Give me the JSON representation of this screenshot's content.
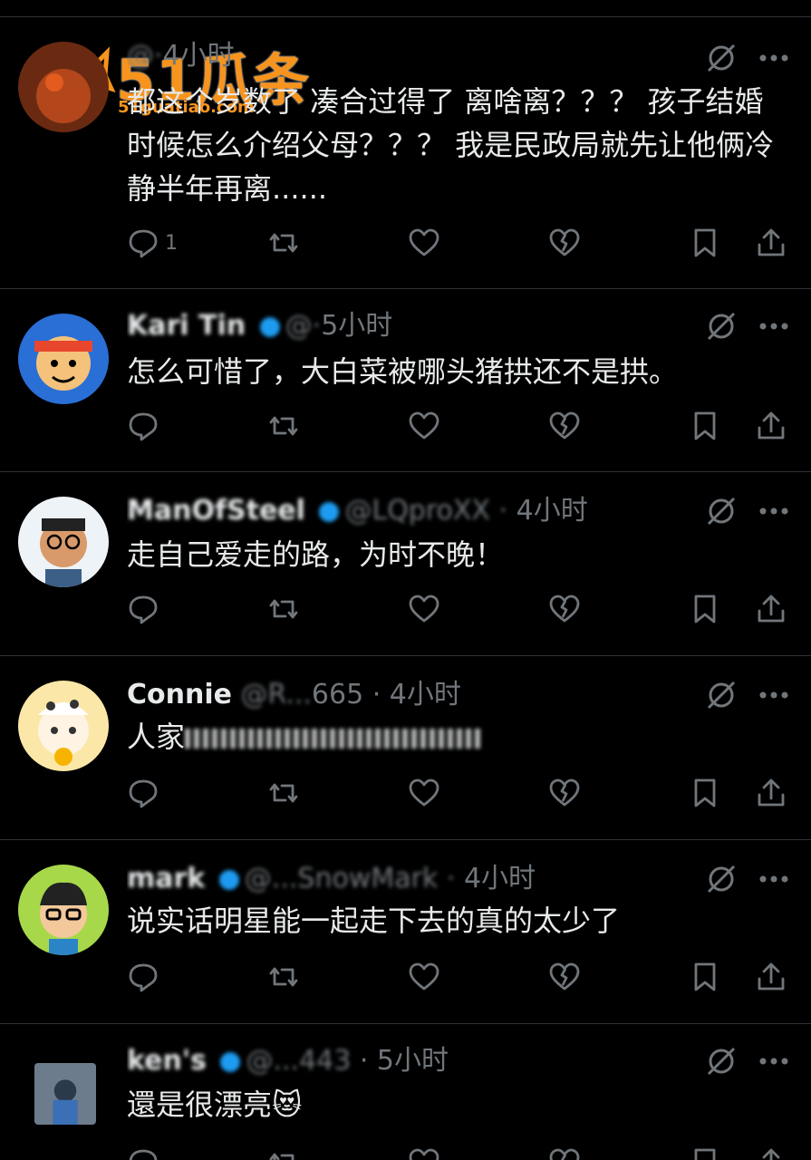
{
  "watermark": {
    "brand": "51瓜条",
    "url": "51guatiao.com"
  },
  "posts": [
    {
      "name": "",
      "handle": "",
      "time": "4小时",
      "text": "都这个岁数了 凑合过得了 离啥离？？？ 孩子结婚时候怎么介绍父母？？？ 我是民政局就先让他俩冷静半年再离......",
      "reply_count": "1"
    },
    {
      "name": "Kari Tin",
      "handle": "",
      "time": "5小时",
      "text": "怎么可惜了，大白菜被哪头猪拱还不是拱。",
      "reply_count": ""
    },
    {
      "name": "ManOfSteel",
      "handle": "@LQproXX",
      "time": "4小时",
      "text": "走自己爱走的路，为时不晚！",
      "reply_count": ""
    },
    {
      "name": "Connie",
      "handle": "@R",
      "time": "4小时",
      "text_visible": "人家",
      "text": "人家",
      "reply_count": ""
    },
    {
      "name": "mark",
      "handle": "@...SnowMark",
      "time": "4小时",
      "text": "说实话明星能一起走下去的真的太少了",
      "reply_count": ""
    },
    {
      "name": "ken's",
      "handle": "",
      "time": "5小时",
      "text": "還是很漂亮😻",
      "reply_count": ""
    }
  ],
  "post4_handle_tail": "665",
  "post6_handle_tail": "443",
  "icons": [
    "reply-icon",
    "retweet-icon",
    "like-icon",
    "dislike-icon",
    "bookmark-icon",
    "share-icon",
    "mute-icon",
    "more-icon"
  ]
}
